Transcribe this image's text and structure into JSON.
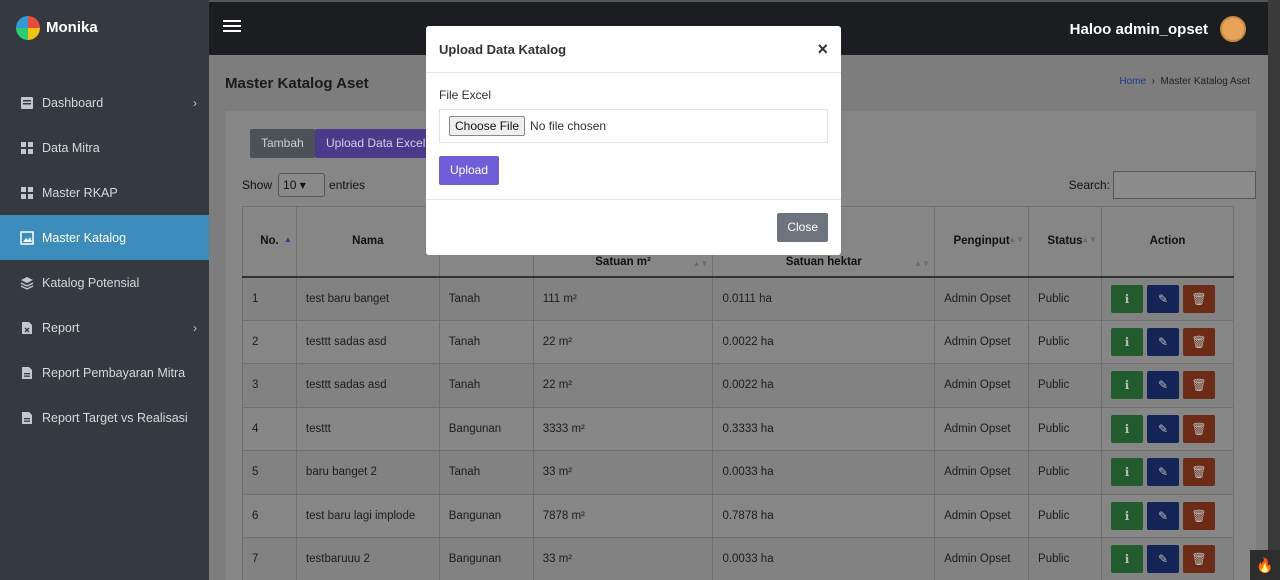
{
  "brand": {
    "name": "Monika"
  },
  "sidebar": {
    "items": [
      {
        "label": "Dashboard",
        "icon": "dashboard-icon",
        "chevron": true
      },
      {
        "label": "Data Mitra",
        "icon": "grid-icon"
      },
      {
        "label": "Master RKAP",
        "icon": "grid-icon"
      },
      {
        "label": "Master Katalog",
        "icon": "image-icon",
        "active": true
      },
      {
        "label": "Katalog Potensial",
        "icon": "layers-icon"
      },
      {
        "label": "Report",
        "icon": "report-icon",
        "chevron": true
      },
      {
        "label": "Report Pembayaran Mitra",
        "icon": "document-icon"
      },
      {
        "label": "Report Target vs Realisasi",
        "icon": "document-icon"
      }
    ]
  },
  "header": {
    "user_greeting": "Haloo admin_opset"
  },
  "page": {
    "title": "Master Katalog Aset",
    "breadcrumb": {
      "home": "Home",
      "current": "Master Katalog Aset"
    }
  },
  "toolbar": {
    "tambah": "Tambah",
    "upload": "Upload Data Excel"
  },
  "table_controls": {
    "show_label": "Show",
    "entries_value": "10",
    "entries_label": "entries",
    "search_label": "Search:"
  },
  "table": {
    "headers": {
      "no": "No.",
      "nama": "Nama",
      "satuan_m2": "Satuan m²",
      "satuan_hektar": "Satuan hektar",
      "penginput": "Penginput",
      "status": "Status",
      "action": "Action"
    },
    "rows": [
      {
        "no": "1",
        "nama": "test baru banget",
        "jenis": "Tanah",
        "m2": "111 m²",
        "ha": "0.0111 ha",
        "penginput": "Admin Opset",
        "status": "Public"
      },
      {
        "no": "2",
        "nama": "testtt sadas asd",
        "jenis": "Tanah",
        "m2": "22 m²",
        "ha": "0.0022 ha",
        "penginput": "Admin Opset",
        "status": "Public"
      },
      {
        "no": "3",
        "nama": "testtt sadas asd",
        "jenis": "Tanah",
        "m2": "22 m²",
        "ha": "0.0022 ha",
        "penginput": "Admin Opset",
        "status": "Public"
      },
      {
        "no": "4",
        "nama": "testtt",
        "jenis": "Bangunan",
        "m2": "3333 m²",
        "ha": "0.3333 ha",
        "penginput": "Admin Opset",
        "status": "Public"
      },
      {
        "no": "5",
        "nama": "baru banget 2",
        "jenis": "Tanah",
        "m2": "33 m²",
        "ha": "0.0033 ha",
        "penginput": "Admin Opset",
        "status": "Public"
      },
      {
        "no": "6",
        "nama": "test baru lagi implode",
        "jenis": "Bangunan",
        "m2": "7878 m²",
        "ha": "0.7878 ha",
        "penginput": "Admin Opset",
        "status": "Public"
      },
      {
        "no": "7",
        "nama": "testbaruuu 2",
        "jenis": "Bangunan",
        "m2": "33 m²",
        "ha": "0.0033 ha",
        "penginput": "Admin Opset",
        "status": "Public"
      }
    ]
  },
  "modal": {
    "title": "Upload Data Katalog",
    "close_symbol": "×",
    "field_label": "File Excel",
    "choose_file": "Choose File",
    "no_file": "No file chosen",
    "upload": "Upload",
    "close": "Close"
  },
  "colors": {
    "sidebar_bg": "#343a40",
    "active": "#3c8dbc",
    "upload_btn": "#6f5ed8"
  }
}
